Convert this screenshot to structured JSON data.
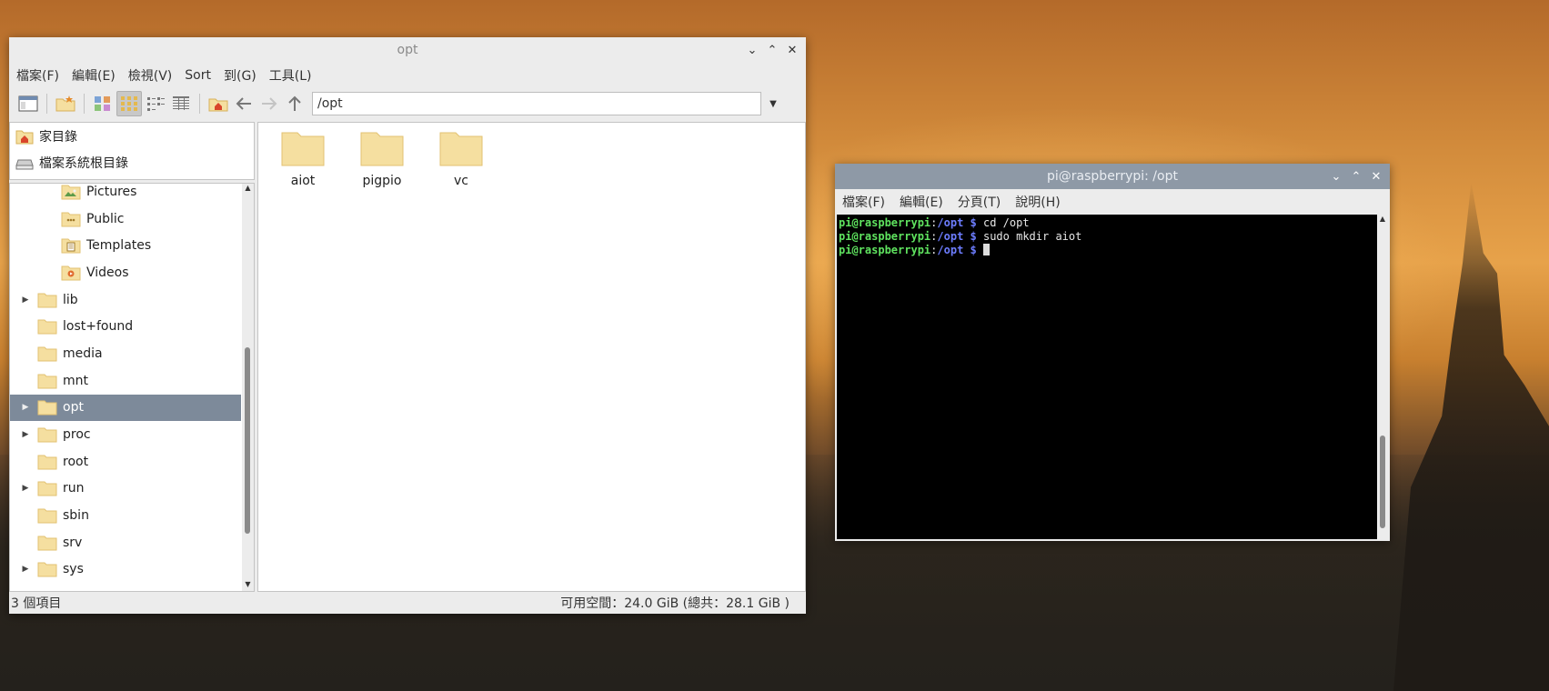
{
  "file_manager": {
    "title": "opt",
    "menu": [
      "檔案(F)",
      "編輯(E)",
      "檢視(V)",
      "Sort",
      "到(G)",
      "工具(L)"
    ],
    "path": "/opt",
    "places": [
      {
        "label": "家目錄",
        "icon": "home-icon"
      },
      {
        "label": "檔案系統根目錄",
        "icon": "drive-icon"
      }
    ],
    "tree": [
      {
        "label": "Pictures",
        "icon": "pictures-folder-icon",
        "indent": 2,
        "expander": false,
        "selected": false
      },
      {
        "label": "Public",
        "icon": "public-folder-icon",
        "indent": 2,
        "expander": false,
        "selected": false
      },
      {
        "label": "Templates",
        "icon": "templates-folder-icon",
        "indent": 2,
        "expander": false,
        "selected": false
      },
      {
        "label": "Videos",
        "icon": "videos-folder-icon",
        "indent": 2,
        "expander": false,
        "selected": false
      },
      {
        "label": "lib",
        "icon": "folder-icon",
        "indent": 1,
        "expander": true,
        "selected": false
      },
      {
        "label": "lost+found",
        "icon": "folder-icon",
        "indent": 1,
        "expander": false,
        "selected": false
      },
      {
        "label": "media",
        "icon": "folder-icon",
        "indent": 1,
        "expander": false,
        "selected": false
      },
      {
        "label": "mnt",
        "icon": "folder-icon",
        "indent": 1,
        "expander": false,
        "selected": false
      },
      {
        "label": "opt",
        "icon": "folder-icon",
        "indent": 1,
        "expander": true,
        "selected": true
      },
      {
        "label": "proc",
        "icon": "folder-icon",
        "indent": 1,
        "expander": true,
        "selected": false
      },
      {
        "label": "root",
        "icon": "folder-icon",
        "indent": 1,
        "expander": false,
        "selected": false
      },
      {
        "label": "run",
        "icon": "folder-icon",
        "indent": 1,
        "expander": true,
        "selected": false
      },
      {
        "label": "sbin",
        "icon": "folder-icon",
        "indent": 1,
        "expander": false,
        "selected": false
      },
      {
        "label": "srv",
        "icon": "folder-icon",
        "indent": 1,
        "expander": false,
        "selected": false
      },
      {
        "label": "sys",
        "icon": "folder-icon",
        "indent": 1,
        "expander": true,
        "selected": false
      }
    ],
    "files": [
      {
        "name": "aiot"
      },
      {
        "name": "pigpio"
      },
      {
        "name": "vc"
      }
    ],
    "status": {
      "count": "3 個項目",
      "space": "可用空間：24.0 GiB (總共：28.1 GiB )"
    }
  },
  "terminal": {
    "title": "pi@raspberrypi: /opt",
    "menu": [
      "檔案(F)",
      "編輯(E)",
      "分頁(T)",
      "說明(H)"
    ],
    "lines": [
      {
        "user": "pi@raspberrypi",
        "sep": ":",
        "path": "/opt",
        "prompt": " $ ",
        "cmd": "cd /opt"
      },
      {
        "user": "pi@raspberrypi",
        "sep": ":",
        "path": "/opt",
        "prompt": " $ ",
        "cmd": "sudo mkdir aiot"
      },
      {
        "user": "pi@raspberrypi",
        "sep": ":",
        "path": "/opt",
        "prompt": " $ ",
        "cmd": ""
      }
    ]
  },
  "colors": {
    "selection": "#7d8a9a",
    "folder": "#f5dfa0",
    "folder_edge": "#e2c272",
    "term_user": "#5fe35f",
    "term_path": "#6d7dff"
  }
}
